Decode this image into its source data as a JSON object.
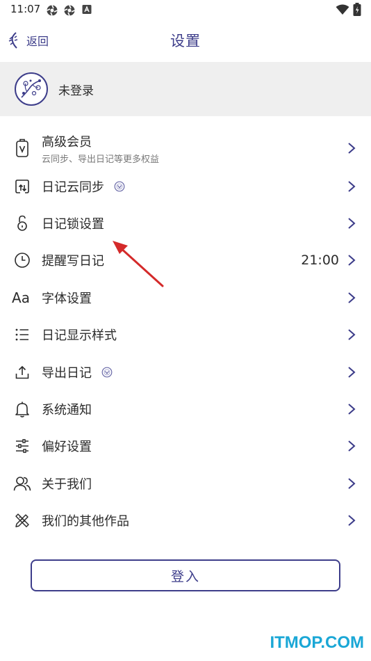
{
  "status_bar": {
    "time": "11:07"
  },
  "header": {
    "back_label": "返回",
    "title": "设置"
  },
  "profile": {
    "name": "未登录"
  },
  "menu": [
    {
      "label": "高级会员",
      "sub": "云同步、导出日记等更多权益",
      "value": "",
      "icon": "vip-card-icon"
    },
    {
      "label": "日记云同步",
      "sub": "",
      "value": "",
      "icon": "cloud-sync-icon",
      "badge": "vip-badge-icon"
    },
    {
      "label": "日记锁设置",
      "sub": "",
      "value": "",
      "icon": "lock-icon"
    },
    {
      "label": "提醒写日记",
      "sub": "",
      "value": "21:00",
      "icon": "clock-icon"
    },
    {
      "label": "字体设置",
      "sub": "",
      "value": "",
      "icon": "font-icon",
      "icon_text": "Aa"
    },
    {
      "label": "日记显示样式",
      "sub": "",
      "value": "",
      "icon": "list-icon"
    },
    {
      "label": "导出日记",
      "sub": "",
      "value": "",
      "icon": "export-icon",
      "badge": "vip-badge-icon"
    },
    {
      "label": "系统通知",
      "sub": "",
      "value": "",
      "icon": "bell-icon"
    },
    {
      "label": "偏好设置",
      "sub": "",
      "value": "",
      "icon": "sliders-icon"
    },
    {
      "label": "关于我们",
      "sub": "",
      "value": "",
      "icon": "people-icon"
    },
    {
      "label": "我们的其他作品",
      "sub": "",
      "value": "",
      "icon": "tools-icon"
    }
  ],
  "login_button": {
    "label": "登入"
  },
  "watermark": {
    "text": "ITMOP.COM"
  },
  "colors": {
    "accent": "#3d3d8a",
    "profile_bg": "#efefef",
    "annotation": "#d42a2a",
    "watermark": "#1aa7d6"
  }
}
